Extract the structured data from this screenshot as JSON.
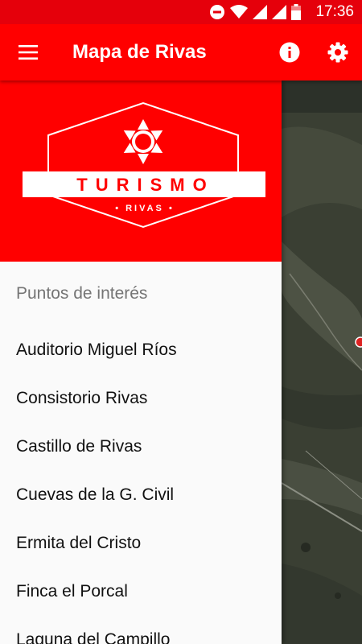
{
  "status_bar": {
    "time": "17:36",
    "icons": [
      "do-not-disturb-icon",
      "wifi-icon",
      "signal-icon",
      "signal-icon",
      "battery-icon"
    ]
  },
  "app_bar": {
    "title": "Mapa de Rivas",
    "menu_icon": "hamburger-menu-icon",
    "info_icon": "info-icon",
    "settings_icon": "gear-icon"
  },
  "drawer": {
    "logo": {
      "word": "TURISMO",
      "sub": "• RIVAS •"
    },
    "section_title": "Puntos de interés",
    "items": [
      {
        "label": "Auditorio Miguel Ríos"
      },
      {
        "label": "Consistorio Rivas"
      },
      {
        "label": "Castillo de Rivas"
      },
      {
        "label": "Cuevas de la G. Civil"
      },
      {
        "label": "Ermita del Cristo"
      },
      {
        "label": "Finca el Porcal"
      },
      {
        "label": "Laguna del Campillo"
      }
    ]
  },
  "colors": {
    "brand_red": "#ff0000",
    "status_red": "#e5000b",
    "drawer_bg": "#fafafa",
    "section_title": "#757575"
  }
}
